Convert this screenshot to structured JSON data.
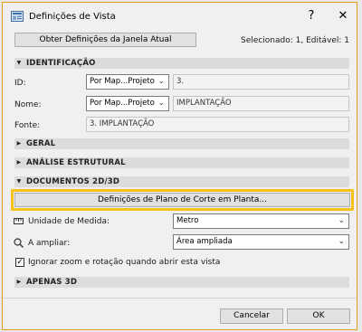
{
  "window": {
    "title": "Definições de Vista",
    "help_label": "?",
    "close_label": "✕"
  },
  "header": {
    "get_settings_label": "Obter Definições da Janela Atual",
    "selection_status": "Selecionado: 1, Editável: 1"
  },
  "sections": {
    "identificacao": "IDENTIFICAÇÃO",
    "geral": "GERAL",
    "analise": "ANÁLISE ESTRUTURAL",
    "documentos": "DOCUMENTOS 2D/3D",
    "apenas3d": "APENAS 3D"
  },
  "identificacao": {
    "id_label": "ID:",
    "id_mode": "Por Map...Projeto",
    "id_value": "3.",
    "name_label": "Nome:",
    "name_mode": "Por Map...Projeto",
    "name_value": "IMPLANTAÇÃO",
    "source_label": "Fonte:",
    "source_value": "3. IMPLANTAÇÃO"
  },
  "documentos": {
    "cut_plane_button": "Definições de Plano de Corte em Planta...",
    "unit_label": "Unidade de Medida:",
    "unit_value": "Metro",
    "zoom_label": "A ampliar:",
    "zoom_value": "Área ampliada",
    "ignore_zoom_label": "Ignorar zoom e rotação quando abrir esta vista",
    "ignore_zoom_checked": true
  },
  "footer": {
    "cancel_label": "Cancelar",
    "ok_label": "OK"
  },
  "colors": {
    "highlight": "#f5c21b",
    "dialog_border": "#e69d1a",
    "section_bg": "#dcdcdc"
  }
}
